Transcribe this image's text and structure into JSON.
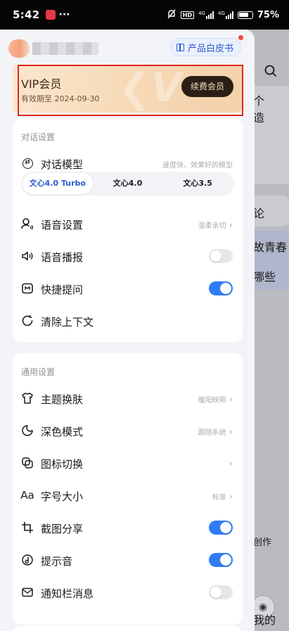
{
  "status_bar": {
    "time": "5:42",
    "dots": "···",
    "network_badge": "HD",
    "network_a": "4G",
    "network_b": "4G",
    "battery": "75%"
  },
  "background_app": {
    "snippets": [
      "个",
      "造",
      "论",
      "故青春",
      "哪些",
      "创作",
      "我的"
    ]
  },
  "drawer": {
    "whitepaper_label": "产品白皮书",
    "vip": {
      "title": "VIP会员",
      "expiry": "有效期至 2024-09-30",
      "renew_label": "续费会员"
    },
    "dialog_settings": {
      "title": "对话设置",
      "model_label": "对话模型",
      "model_desc": "速度快、效果好的模型",
      "model_options": [
        "文心4.0 Turbo",
        "文心4.0",
        "文心3.5"
      ],
      "selected_model": "文心4.0 Turbo",
      "voice_settings_label": "语音设置",
      "voice_settings_value": "温柔亲切",
      "voice_broadcast_label": "语音播报",
      "voice_broadcast_on": false,
      "quick_question_label": "快捷提问",
      "quick_question_on": true,
      "clear_context_label": "清除上下文"
    },
    "general_settings": {
      "title": "通用设置",
      "theme_label": "主题换肤",
      "theme_value": "暖阳映照",
      "dark_mode_label": "深色模式",
      "dark_mode_value": "跟随系统",
      "icon_switch_label": "图标切换",
      "font_size_label": "字号大小",
      "font_size_value": "标准",
      "screenshot_share_label": "截图分享",
      "screenshot_share_on": true,
      "notification_sound_label": "提示音",
      "notification_sound_on": true,
      "notification_bar_label": "通知栏消息",
      "notification_bar_on": false
    }
  },
  "colors": {
    "accent": "#2f7df6",
    "highlight_border": "#e0281c",
    "vip_button": "#2a1f14"
  }
}
